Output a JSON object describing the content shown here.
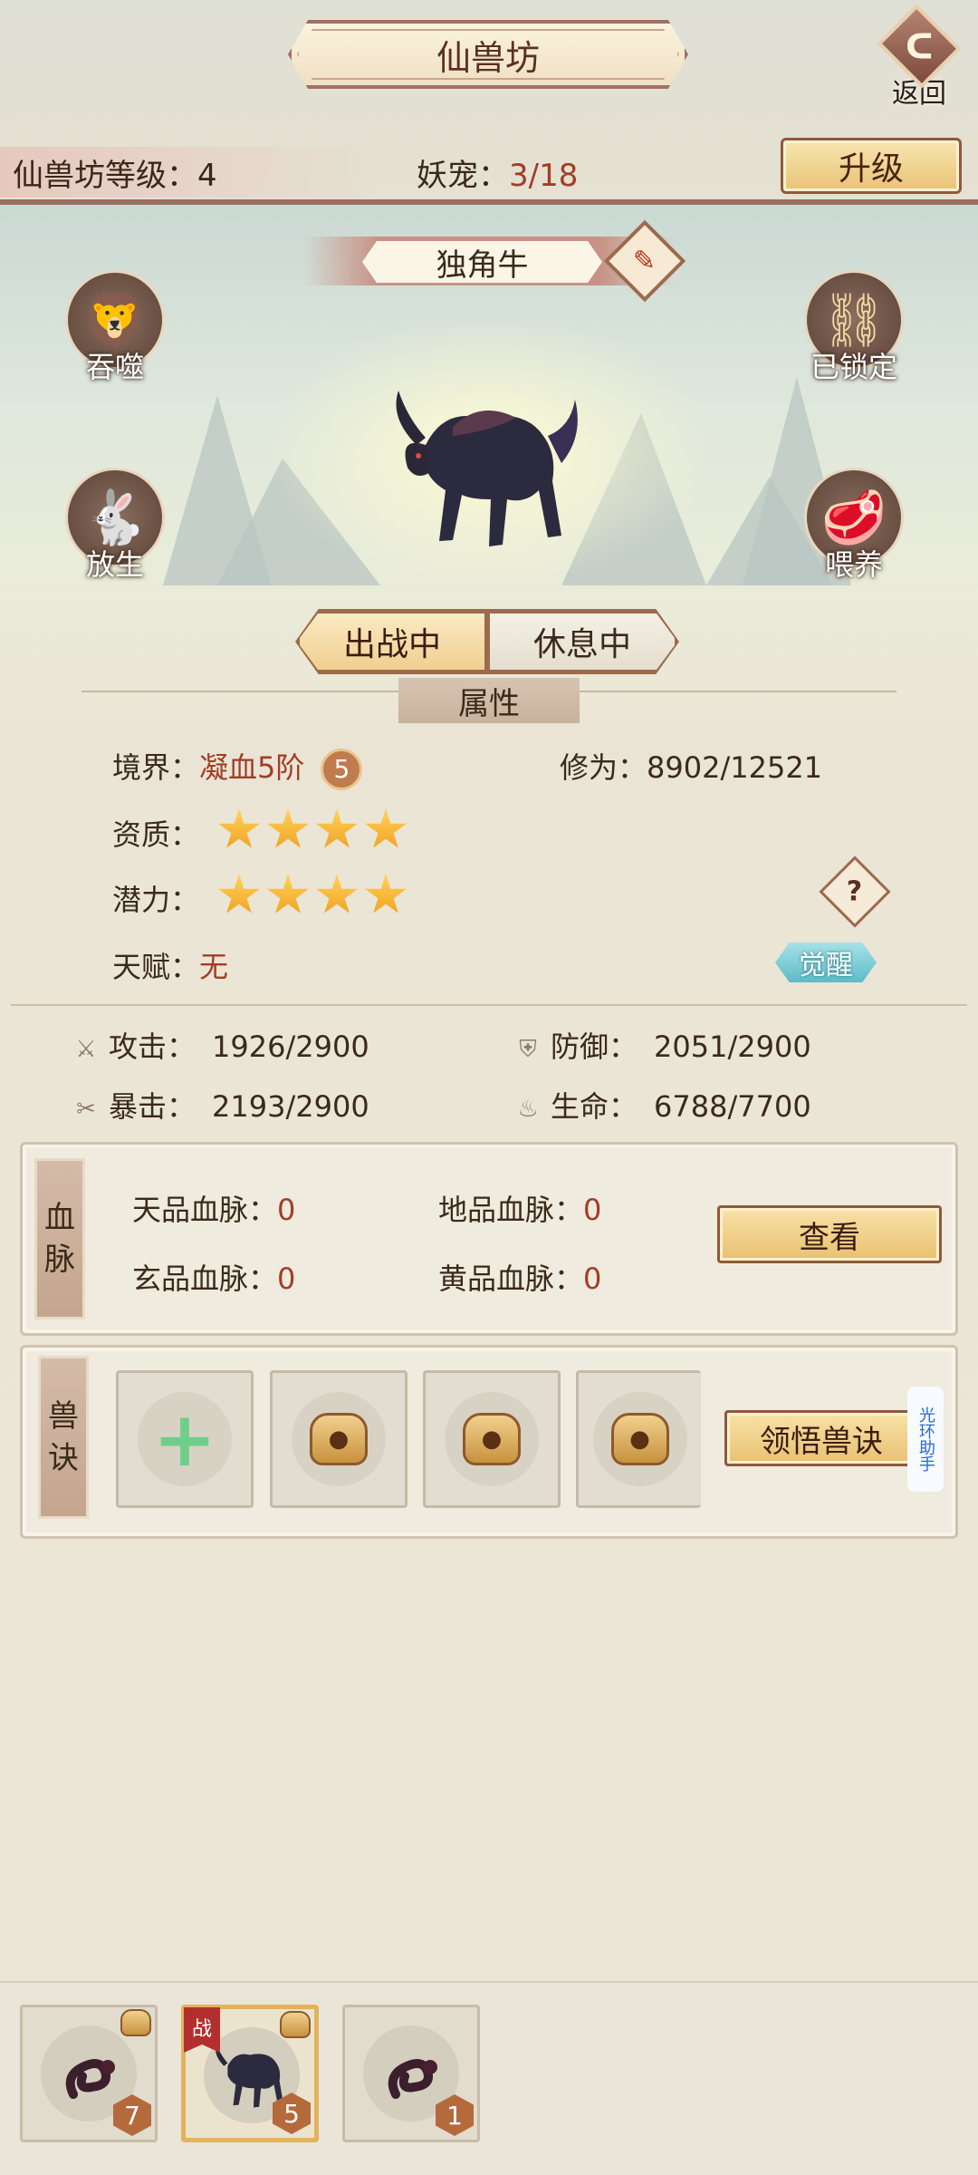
{
  "header": {
    "title": "仙兽坊",
    "back_label": "返回",
    "level_label": "仙兽坊等级：",
    "level_value": "4",
    "pet_label": "妖宠：",
    "pet_value": "3/18",
    "upgrade_label": "升级"
  },
  "pet": {
    "name": "独角牛",
    "actions": {
      "devour": "吞噬",
      "locked": "已锁定",
      "release": "放生",
      "feed": "喂养"
    },
    "tabs": [
      "出战中",
      "休息中"
    ],
    "active_tab": "出战中"
  },
  "attributes": {
    "section_title": "属性",
    "realm_label": "境界：",
    "realm_value": "凝血5阶",
    "realm_badge": "5",
    "cultivation_label": "修为：",
    "cultivation_value": "8902/12521",
    "aptitude_label": "资质：",
    "aptitude_stars": 4,
    "potential_label": "潜力：",
    "potential_stars": 4,
    "talent_label": "天赋：",
    "talent_value": "无",
    "help_icon": "?",
    "awaken_label": "觉醒"
  },
  "stats": {
    "attack_label": "攻击：",
    "attack_value": "1926/2900",
    "defense_label": "防御：",
    "defense_value": "2051/2900",
    "crit_label": "暴击：",
    "crit_value": "2193/2900",
    "life_label": "生命：",
    "life_value": "6788/7700"
  },
  "bloodline": {
    "tag": [
      "血",
      "脉"
    ],
    "heaven_label": "天品血脉：",
    "heaven_value": "0",
    "earth_label": "地品血脉：",
    "earth_value": "0",
    "mystic_label": "玄品血脉：",
    "mystic_value": "0",
    "yellow_label": "黄品血脉：",
    "yellow_value": "0",
    "view_label": "查看"
  },
  "skills": {
    "tag": [
      "兽",
      "诀"
    ],
    "learn_label": "领悟兽诀",
    "assistant_label": "光环助手"
  },
  "pet_list": [
    {
      "level": "7",
      "battle": false,
      "selected": false
    },
    {
      "level": "5",
      "battle": true,
      "battle_label": "战",
      "selected": true
    },
    {
      "level": "1",
      "battle": false,
      "selected": false
    }
  ],
  "colors": {
    "accent_red": "#a23d25",
    "button_gold": "#e9c071",
    "awaken_cyan": "#5fbac6",
    "star_gold": "#f0a020"
  }
}
